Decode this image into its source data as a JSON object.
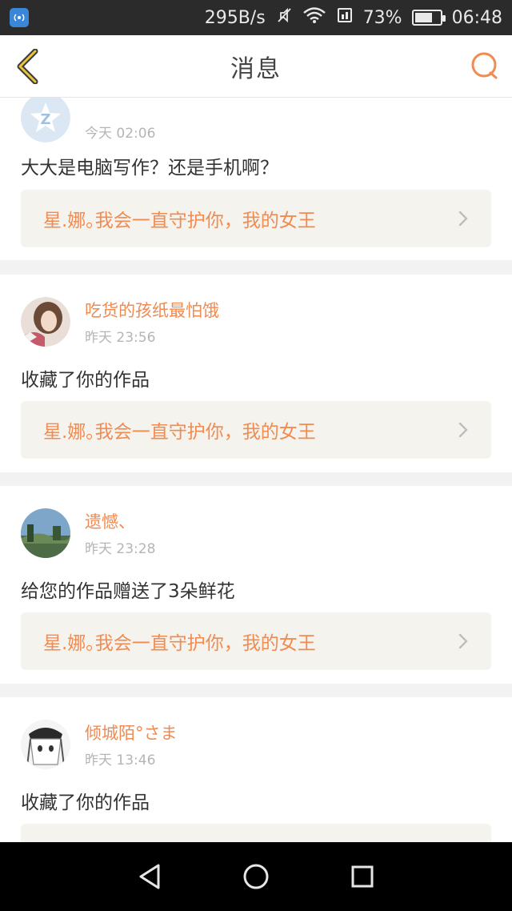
{
  "status_bar": {
    "speed": "295B/s",
    "battery": "73%",
    "time": "06:48",
    "battery_level": 0.73
  },
  "header": {
    "title": "消息"
  },
  "colors": {
    "accent": "#f08b52",
    "link_bg": "#f5f3ee"
  },
  "messages": [
    {
      "user": "",
      "time": "今天 02:06",
      "text": "大大是电脑写作？还是手机啊？",
      "work_title": "星.娜｡我会一直守护你，我的女王",
      "avatar_icon": "qzone-icon"
    },
    {
      "user": "吃货的孩纸最怕饿",
      "time": "昨天 23:56",
      "text": "收藏了你的作品",
      "work_title": "星.娜｡我会一直守护你，我的女王",
      "avatar_icon": "girl-photo-avatar"
    },
    {
      "user": "遗憾、",
      "time": "昨天 23:28",
      "text": "给您的作品赠送了3朵鲜花",
      "work_title": "星.娜｡我会一直守护你，我的女王",
      "avatar_icon": "landscape-avatar"
    },
    {
      "user": "倾城陌°さま",
      "time": "昨天 13:46",
      "text": "收藏了你的作品",
      "work_title": "",
      "avatar_icon": "anime-avatar"
    }
  ]
}
